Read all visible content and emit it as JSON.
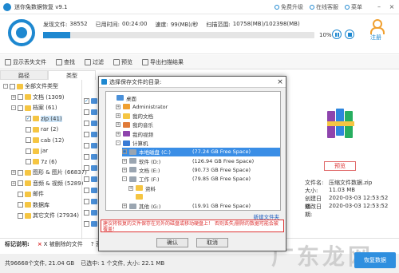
{
  "app": {
    "title": "迷你兔数据恢复 v9.1"
  },
  "titlebar": {
    "links": [
      "免费升级",
      "在线客服",
      "菜单"
    ]
  },
  "scan": {
    "stats": [
      {
        "label": "发现文件:",
        "value": "38552"
      },
      {
        "label": "已用时间:",
        "value": "00:24:00"
      },
      {
        "label": "速度:",
        "value": "99(MB)/秒"
      },
      {
        "label": "扫描范围:",
        "value": "10758(MB)/102398(MB)"
      }
    ],
    "progress_percent": 10,
    "percent_label": "10%",
    "register_label": "注册"
  },
  "toolbar": {
    "items": [
      "显示丢失文件",
      "查找",
      "过滤",
      "预览",
      "导出扫描结果"
    ]
  },
  "tabs": {
    "path": "路径",
    "type": "类型"
  },
  "tree": {
    "items": [
      {
        "label": "全部文件类型",
        "indent": 0,
        "exp": "-",
        "checked": false
      },
      {
        "label": "文档 (1309)",
        "indent": 1,
        "exp": "+",
        "checked": false
      },
      {
        "label": "档案 (61)",
        "indent": 1,
        "exp": "-",
        "checked": false
      },
      {
        "label": "zip (41)",
        "indent": 2,
        "exp": "",
        "checked": true,
        "selected": true
      },
      {
        "label": "rar (2)",
        "indent": 2,
        "exp": "",
        "checked": false
      },
      {
        "label": "cab (12)",
        "indent": 2,
        "exp": "",
        "checked": false
      },
      {
        "label": "jar",
        "indent": 2,
        "exp": "",
        "checked": false
      },
      {
        "label": "7z (6)",
        "indent": 2,
        "exp": "",
        "checked": false
      },
      {
        "label": "图形 & 图片 (66837)",
        "indent": 1,
        "exp": "+",
        "checked": false
      },
      {
        "label": "音频 & 视频 (5289)",
        "indent": 1,
        "exp": "+",
        "checked": false
      },
      {
        "label": "邮件",
        "indent": 1,
        "exp": "",
        "checked": false
      },
      {
        "label": "数据库",
        "indent": 1,
        "exp": "",
        "checked": false
      },
      {
        "label": "其它文件 (27934)",
        "indent": 1,
        "exp": "",
        "checked": false
      }
    ]
  },
  "preview": {
    "button": "预览",
    "meta": [
      {
        "key": "文件名:",
        "value": "压缩文件数据.zip"
      },
      {
        "key": "大小:",
        "value": "11.03 MB"
      },
      {
        "key": "创建日期:",
        "value": "2020-03-03 12:53:52"
      },
      {
        "key": "修改日期:",
        "value": "2020-03-03 12:53:52"
      }
    ]
  },
  "legend": {
    "title": "标记说明:",
    "items": [
      "X 被删除的文件",
      "? 丢失的文件"
    ]
  },
  "status": {
    "total": "共96668个文件, 21.04 GB",
    "selected": "已选中: 1 个文件, 大小: 22.1 MB"
  },
  "recover_button": "恢复数据",
  "watermark": "广东龙网",
  "dialog": {
    "title": "选择保存文件的目录:",
    "close": "×",
    "tree": [
      {
        "label": "桌面",
        "indent": 0,
        "exp": ""
      },
      {
        "label": "Administrator",
        "indent": 1,
        "exp": "+"
      },
      {
        "label": "我的文档",
        "indent": 1,
        "exp": "+"
      },
      {
        "label": "我的音乐",
        "indent": 1,
        "exp": "+"
      },
      {
        "label": "我的视频",
        "indent": 1,
        "exp": "+"
      },
      {
        "label": "计算机",
        "indent": 1,
        "exp": "-"
      },
      {
        "label": "本地磁盘 (C:)",
        "free": "(77.24 GB Free Space)",
        "indent": 2,
        "exp": "+",
        "selected": true
      },
      {
        "label": "软件 (D:)",
        "free": "(126.94 GB Free Space)",
        "indent": 2,
        "exp": "+"
      },
      {
        "label": "文档 (E:)",
        "free": "(90.73 GB Free Space)",
        "indent": 2,
        "exp": "+"
      },
      {
        "label": "工作 (F:)",
        "free": "(79.85 GB Free Space)",
        "indent": 2,
        "exp": "-"
      },
      {
        "label": "资料",
        "indent": 3,
        "exp": "+"
      },
      {
        "label": "",
        "indent": 3,
        "exp": ""
      },
      {
        "label": "其他 (G:)",
        "free": "(19.91 GB Free Space)",
        "indent": 2,
        "exp": "+"
      }
    ],
    "advanced_link": "新建文件夹",
    "warning": "建议将恢复的文件保存在另外的磁盘或移动硬盘上！ 否则丢失/删除的数据可能会被覆盖！",
    "ok": "确认",
    "cancel": "取消"
  }
}
